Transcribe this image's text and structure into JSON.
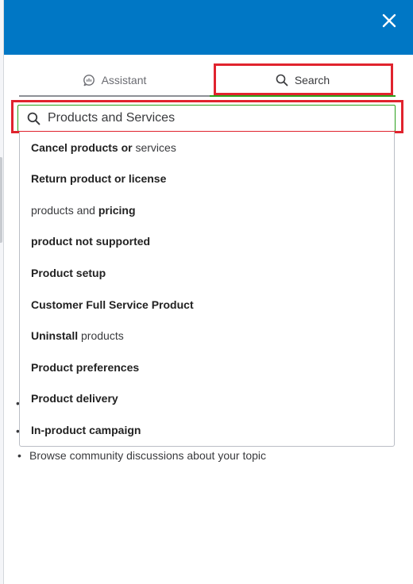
{
  "header": {
    "close_label": "×"
  },
  "tabs": [
    {
      "label": "Assistant"
    },
    {
      "label": "Search"
    }
  ],
  "search": {
    "value": "Products and Services",
    "placeholder": ""
  },
  "suggestions": [
    {
      "parts": [
        {
          "text": "Cancel products or ",
          "bold": true
        },
        {
          "text": "services",
          "bold": false
        }
      ]
    },
    {
      "parts": [
        {
          "text": "Return product or license",
          "bold": true
        }
      ]
    },
    {
      "parts": [
        {
          "text": "products and ",
          "bold": false
        },
        {
          "text": "pricing",
          "bold": true
        }
      ]
    },
    {
      "parts": [
        {
          "text": "product not supported",
          "bold": true
        }
      ]
    },
    {
      "parts": [
        {
          "text": "Product setup",
          "bold": true
        }
      ]
    },
    {
      "parts": [
        {
          "text": "Customer Full Service Product",
          "bold": true
        }
      ]
    },
    {
      "parts": [
        {
          "text": "Uninstall",
          "bold": true
        },
        {
          "text": " products",
          "bold": false
        }
      ]
    },
    {
      "parts": [
        {
          "text": "Product preferences",
          "bold": true
        }
      ]
    },
    {
      "parts": [
        {
          "text": "Product delivery",
          "bold": true
        }
      ]
    },
    {
      "parts": [
        {
          "text": "In-product campaign",
          "bold": true
        }
      ]
    }
  ],
  "background": {
    "bullet_items": [
      "Browse community discussions about your topic"
    ]
  },
  "colors": {
    "header": "#0077c5",
    "active_tab_underline": "#2ca01c",
    "highlight": "#e0232e"
  }
}
